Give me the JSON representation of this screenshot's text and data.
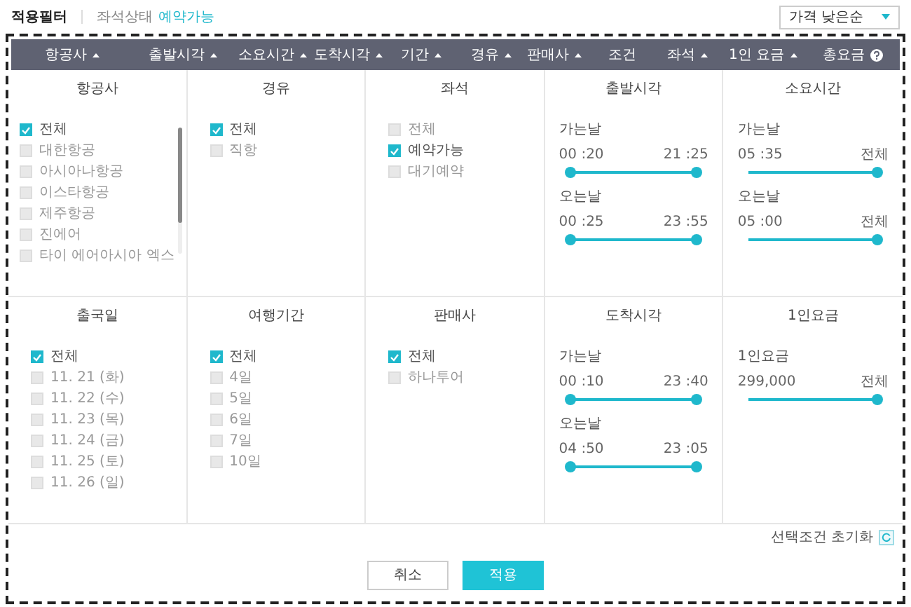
{
  "topbar": {
    "title": "적용필터",
    "filter_label": "좌석상태",
    "filter_value": "예약가능",
    "sort_select": {
      "value": "가격 낮은순"
    }
  },
  "header": [
    {
      "label": "항공사",
      "kind": "sort"
    },
    {
      "label": "출발시각",
      "kind": "sort"
    },
    {
      "label": "소요시간",
      "kind": "sort"
    },
    {
      "label": "도착시각",
      "kind": "sort"
    },
    {
      "label": "기간",
      "kind": "sort"
    },
    {
      "label": "경유",
      "kind": "sort"
    },
    {
      "label": "판매사",
      "kind": "sort"
    },
    {
      "label": "조건",
      "kind": "plain"
    },
    {
      "label": "좌석",
      "kind": "sort"
    },
    {
      "label": "1인 요금",
      "kind": "sort"
    },
    {
      "label": "총요금",
      "kind": "help"
    }
  ],
  "panels": [
    {
      "kind": "checks",
      "title": "항공사",
      "scroll": true,
      "options": [
        {
          "label": "전체",
          "checked": true
        },
        {
          "label": "대한항공",
          "checked": false
        },
        {
          "label": "아시아나항공",
          "checked": false
        },
        {
          "label": "이스타항공",
          "checked": false
        },
        {
          "label": "제주항공",
          "checked": false
        },
        {
          "label": "진에어",
          "checked": false
        },
        {
          "label": "타이 에어아시아 엑스",
          "checked": false
        }
      ]
    },
    {
      "kind": "checks",
      "title": "경유",
      "options": [
        {
          "label": "전체",
          "checked": true
        },
        {
          "label": "직항",
          "checked": false
        }
      ]
    },
    {
      "kind": "checks",
      "title": "좌석",
      "options": [
        {
          "label": "전체",
          "checked": false
        },
        {
          "label": "예약가능",
          "checked": true
        },
        {
          "label": "대기예약",
          "checked": false
        }
      ]
    },
    {
      "kind": "sliders",
      "title": "출발시각",
      "sliders": [
        {
          "label": "가는날",
          "min_text": "00 :20",
          "max_text": "21 :25",
          "thumbs": [
            {
              "level": 0
            },
            {
              "level": 1
            }
          ]
        },
        {
          "label": "오는날",
          "min_text": "00 :25",
          "max_text": "23 :55",
          "thumbs": [
            {
              "level": 0
            },
            {
              "level": 1
            }
          ]
        }
      ]
    },
    {
      "kind": "sliders",
      "title": "소요시간",
      "sliders": [
        {
          "label": "가는날",
          "min_text": "05 :35",
          "max_text": "전체",
          "thumbs": [
            {
              "level": 1
            }
          ]
        },
        {
          "label": "오는날",
          "min_text": "05 :00",
          "max_text": "전체",
          "thumbs": [
            {
              "level": 1
            }
          ]
        }
      ]
    },
    {
      "kind": "checks",
      "title": "출국일",
      "options": [
        {
          "label": "전체",
          "checked": true
        },
        {
          "label": "11. 21 (화)",
          "checked": false
        },
        {
          "label": "11. 22 (수)",
          "checked": false
        },
        {
          "label": "11. 23 (목)",
          "checked": false
        },
        {
          "label": "11. 24 (금)",
          "checked": false
        },
        {
          "label": "11. 25 (토)",
          "checked": false
        },
        {
          "label": "11. 26 (일)",
          "checked": false
        }
      ]
    },
    {
      "kind": "checks",
      "title": "여행기간",
      "options": [
        {
          "label": "전체",
          "checked": true
        },
        {
          "label": "4일",
          "checked": false
        },
        {
          "label": "5일",
          "checked": false
        },
        {
          "label": "6일",
          "checked": false
        },
        {
          "label": "7일",
          "checked": false
        },
        {
          "label": "10일",
          "checked": false
        }
      ]
    },
    {
      "kind": "checks",
      "title": "판매사",
      "options": [
        {
          "label": "전체",
          "checked": true
        },
        {
          "label": "하나투어",
          "checked": false
        }
      ]
    },
    {
      "kind": "sliders",
      "title": "도착시각",
      "sliders": [
        {
          "label": "가는날",
          "min_text": "00 :10",
          "max_text": "23 :40",
          "thumbs": [
            {
              "level": 0
            },
            {
              "level": 1
            }
          ]
        },
        {
          "label": "오는날",
          "min_text": "04 :50",
          "max_text": "23 :05",
          "thumbs": [
            {
              "level": 0
            },
            {
              "level": 1
            }
          ]
        }
      ]
    },
    {
      "kind": "sliders",
      "title": "1인요금",
      "sliders": [
        {
          "label": "1인요금",
          "min_text": "299,000",
          "max_text": "전체",
          "thumbs": [
            {
              "level": 1
            }
          ]
        }
      ]
    }
  ],
  "reset": {
    "label": "선택조건 초기화"
  },
  "buttons": [
    {
      "label": "취소",
      "kind": "secondary"
    },
    {
      "label": "적용",
      "kind": "primary"
    }
  ]
}
